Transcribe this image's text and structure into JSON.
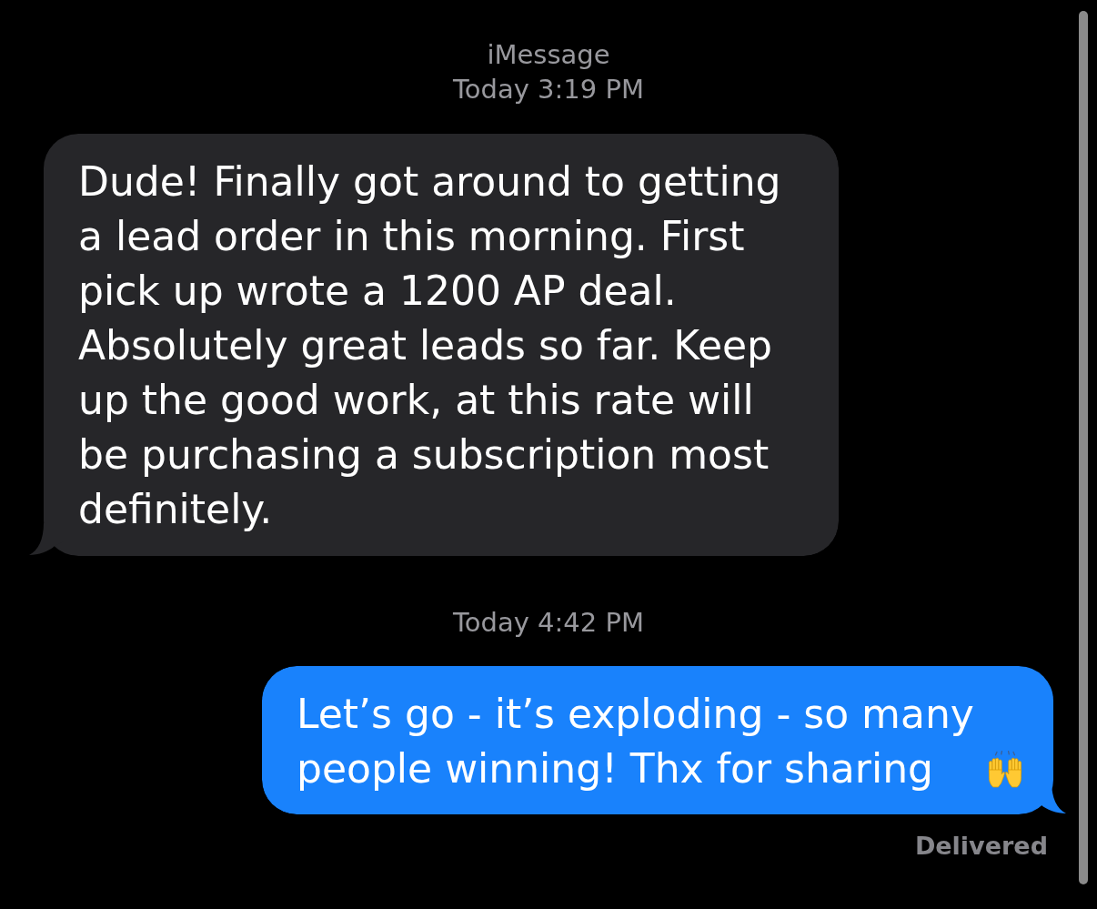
{
  "header": {
    "service": "iMessage",
    "time": "Today 3:19 PM"
  },
  "thread": [
    {
      "kind": "received",
      "text": "Dude! Finally got around to getting a lead order in this morning. First pick up wrote a 1200 AP deal. Absolutely great leads so far. Keep up the good work, at this rate will be purchasing a subscription most definitely."
    },
    {
      "kind": "time",
      "text": "Today 4:42 PM"
    },
    {
      "kind": "sent",
      "text": "Let’s go - it’s exploding - so many people winning! Thx for sharing",
      "emoji": true,
      "status": "Delivered"
    }
  ]
}
